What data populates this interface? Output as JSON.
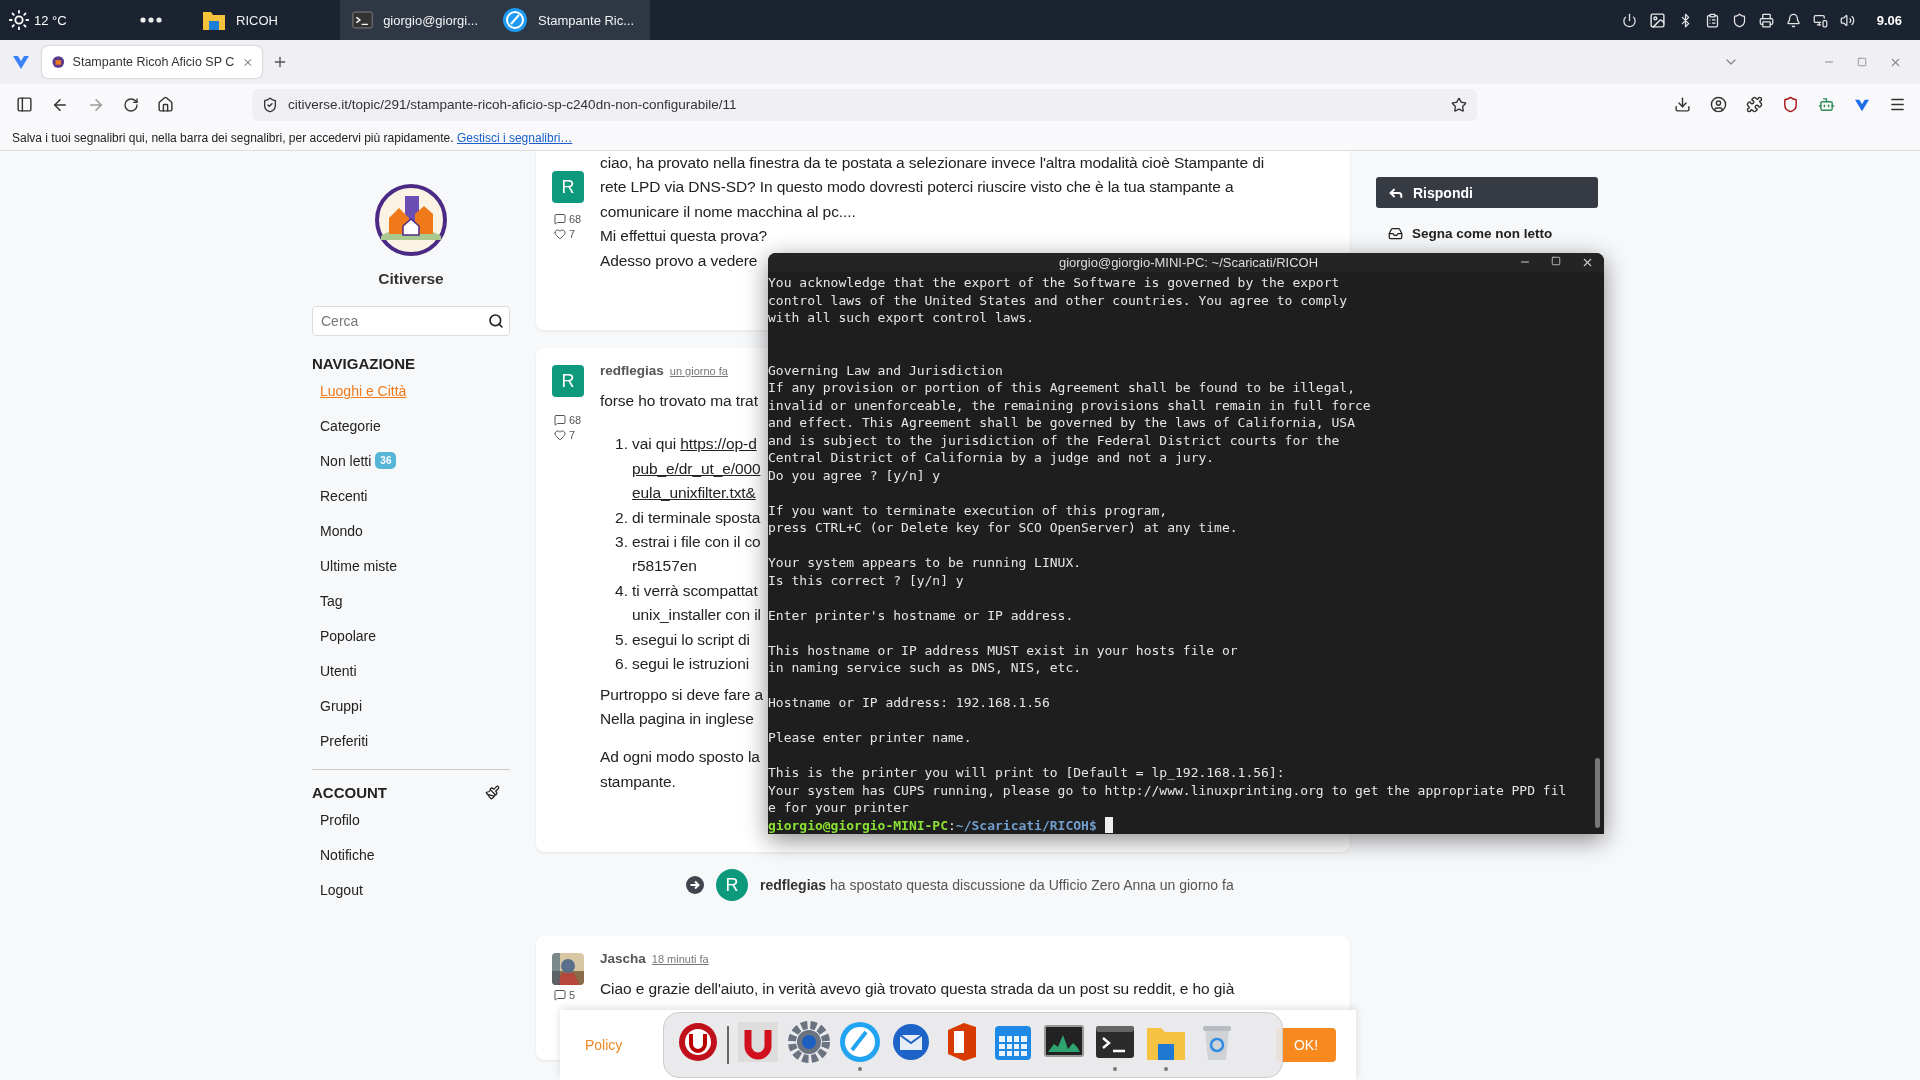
{
  "top_panel": {
    "weather": "12 °C",
    "clock": "9.06",
    "tasks": [
      {
        "kind": "folder",
        "label": "RICOH",
        "selected": false
      },
      {
        "kind": "terminal",
        "label": "giorgio@giorgi...",
        "selected": true
      },
      {
        "kind": "browser",
        "label": "Stampante Ric...",
        "selected": true
      }
    ]
  },
  "browser": {
    "tabs": [
      {
        "label": "Stampante Ricoh Aficio SP C",
        "selected": true
      }
    ],
    "url": "citiverse.it/topic/291/stampante-ricoh-aficio-sp-c240dn-non-configurabile/11",
    "bookmarks_bar": {
      "hint": "Salva i tuoi segnalibri qui, nella barra dei segnalibri, per accedervi più rapidamente.",
      "link": "Gestisci i segnalibri…"
    }
  },
  "sidebar": {
    "site_name": "Citiverse",
    "search": {
      "placeholder": "Cerca"
    },
    "sections": [
      {
        "title": "NAVIGAZIONE",
        "editable": false,
        "items": [
          {
            "label": "Luoghi e Città",
            "selected": true
          },
          {
            "label": "Categorie",
            "selected": false
          },
          {
            "label": "Non letti",
            "badge": "36",
            "selected": false
          },
          {
            "label": "Recenti",
            "selected": false
          },
          {
            "label": "Mondo",
            "selected": false
          },
          {
            "label": "Ultime miste",
            "selected": false
          },
          {
            "label": "Tag",
            "selected": false
          },
          {
            "label": "Popolare",
            "selected": false
          },
          {
            "label": "Utenti",
            "selected": false
          },
          {
            "label": "Gruppi",
            "selected": false
          },
          {
            "label": "Preferiti",
            "selected": false
          }
        ]
      },
      {
        "title": "ACCOUNT",
        "editable": true,
        "items": [
          {
            "label": "Profilo",
            "selected": false
          },
          {
            "label": "Notifiche",
            "selected": false
          },
          {
            "label": "Logout",
            "selected": false
          }
        ]
      }
    ]
  },
  "posts": [
    {
      "kind": "post",
      "avatar": {
        "kind": "letter",
        "letter": "R"
      },
      "comments": "68",
      "likes": "7",
      "blocks": [
        {
          "kind": "text",
          "lines": [
            "ciao, ha provato nella finestra da te postata a selezionare invece l'altra modalità cioè Stampante di",
            "rete LPD via DNS-SD? In questo modo dovresti poterci riuscire visto che è la tua stampante a",
            "comunicare il nome macchina al pc....",
            "Mi effettui questa prova?",
            "Adesso provo a vedere"
          ]
        }
      ]
    },
    {
      "kind": "post",
      "author": "redflegias",
      "time": "un giorno fa",
      "avatar": {
        "kind": "letter",
        "letter": "R"
      },
      "comments": "68",
      "likes": "7",
      "blocks": [
        {
          "kind": "text",
          "lines": [
            "forse ho trovato ma trat"
          ]
        },
        {
          "kind": "list",
          "items": [
            {
              "number": "1.",
              "lines": [
                {
                  "text": "vai qui ",
                  "link": "https://op-d"
                },
                {
                  "link": "pub_e/dr_ut_e/000"
                },
                {
                  "link": "eula_unixfilter.txt&"
                }
              ]
            },
            {
              "number": "2.",
              "lines": [
                {
                  "text": "di terminale sposta"
                }
              ]
            },
            {
              "number": "3.",
              "lines": [
                {
                  "text": "estrai i file con il co"
                },
                {
                  "text": "r58157en"
                }
              ]
            },
            {
              "number": "4.",
              "lines": [
                {
                  "text": "ti verrà scompattat"
                },
                {
                  "text": "unix_installer con il"
                }
              ]
            },
            {
              "number": "5.",
              "lines": [
                {
                  "text": "esegui lo script di"
                }
              ]
            },
            {
              "number": "6.",
              "lines": [
                {
                  "text": "segui le istruzioni"
                }
              ]
            }
          ]
        },
        {
          "kind": "text",
          "lines": [
            "Purtroppo si deve fare a",
            "Nella pagina in inglese"
          ]
        },
        {
          "kind": "text",
          "lines": [
            "Ad ogni modo sposto la",
            "stampante."
          ]
        }
      ]
    },
    {
      "kind": "event",
      "avatar": {
        "kind": "letter",
        "letter": "R"
      },
      "text": "**redflegias** ha spostato questa discussione da Ufficio Zero Anna un giorno fa"
    },
    {
      "kind": "post",
      "author": "Jascha",
      "time": "18 minuti fa",
      "avatar": {
        "kind": "picture"
      },
      "comments": "5",
      "blocks": [
        {
          "kind": "text",
          "lines": [
            "Ciao e grazie dell'aiuto, in verità avevo già trovato questa strada da un post su reddit, e ho già"
          ]
        }
      ]
    }
  ],
  "actions": {
    "reply": "Rispondi",
    "mark_unread": "Segna come non letto"
  },
  "terminal": {
    "title": "giorgio@giorgio-MINI-PC: ~/Scaricati/RICOH",
    "blocks": [
      {
        "wide_gap": false,
        "lines": [
          "You acknowledge that the export of the Software is governed by the export",
          "control laws of the United States and other countries. You agree to comply",
          "with all such export control laws."
        ]
      },
      {
        "wide_gap": true,
        "lines": [
          "Governing Law and Jurisdiction",
          "If any provision or portion of this Agreement shall be found to be illegal,",
          "invalid or unenforceable, the remaining provisions shall remain in full force",
          "and effect. This Agreement shall be governed by the laws of California, USA",
          "and is subject to the jurisdiction of the Federal District courts for the",
          "Central District of California by a judge and not a jury.",
          "Do you agree ? [y/n] y"
        ]
      },
      {
        "wide_gap": false,
        "lines": [
          "If you want to terminate execution of this program,",
          "press CTRL+C (or Delete key for SCO OpenServer) at any time."
        ]
      },
      {
        "wide_gap": false,
        "lines": [
          "Your system appears to be running LINUX.",
          "Is this correct ? [y/n] y"
        ]
      },
      {
        "wide_gap": false,
        "lines": [
          "Enter printer's hostname or IP address."
        ]
      },
      {
        "wide_gap": false,
        "lines": [
          "This hostname or IP address MUST exist in your hosts file or",
          "in naming service such as DNS, NIS, etc."
        ]
      },
      {
        "wide_gap": false,
        "lines": [
          "Hostname or IP address: 192.168.1.56"
        ]
      },
      {
        "wide_gap": false,
        "lines": [
          "Please enter printer name."
        ]
      },
      {
        "wide_gap": false,
        "lines": [
          "This is the printer you will print to [Default = lp_192.168.1.56]:",
          "Your system has CUPS running, please go to http://www.linuxprinting.org to get the appropriate PPD fil",
          "e for your printer"
        ]
      }
    ],
    "prompt": {
      "user": "giorgio@giorgio-MINI-PC",
      "separator": ":",
      "path": "~/Scaricati/RICOH$"
    }
  },
  "cookie_banner": {
    "link": "Policy",
    "button": "OK!"
  },
  "dock": [
    {
      "kind": "ring",
      "running": false
    },
    {
      "kind": "magnet",
      "running": false
    },
    {
      "kind": "gear",
      "running": false
    },
    {
      "kind": "compass",
      "running": true
    },
    {
      "kind": "mail",
      "running": false
    },
    {
      "kind": "office",
      "running": false
    },
    {
      "kind": "calendar",
      "running": false
    },
    {
      "kind": "monitor",
      "running": false
    },
    {
      "kind": "terminal",
      "running": true
    },
    {
      "kind": "folder",
      "running": true
    },
    {
      "kind": "trash",
      "running": false
    }
  ]
}
